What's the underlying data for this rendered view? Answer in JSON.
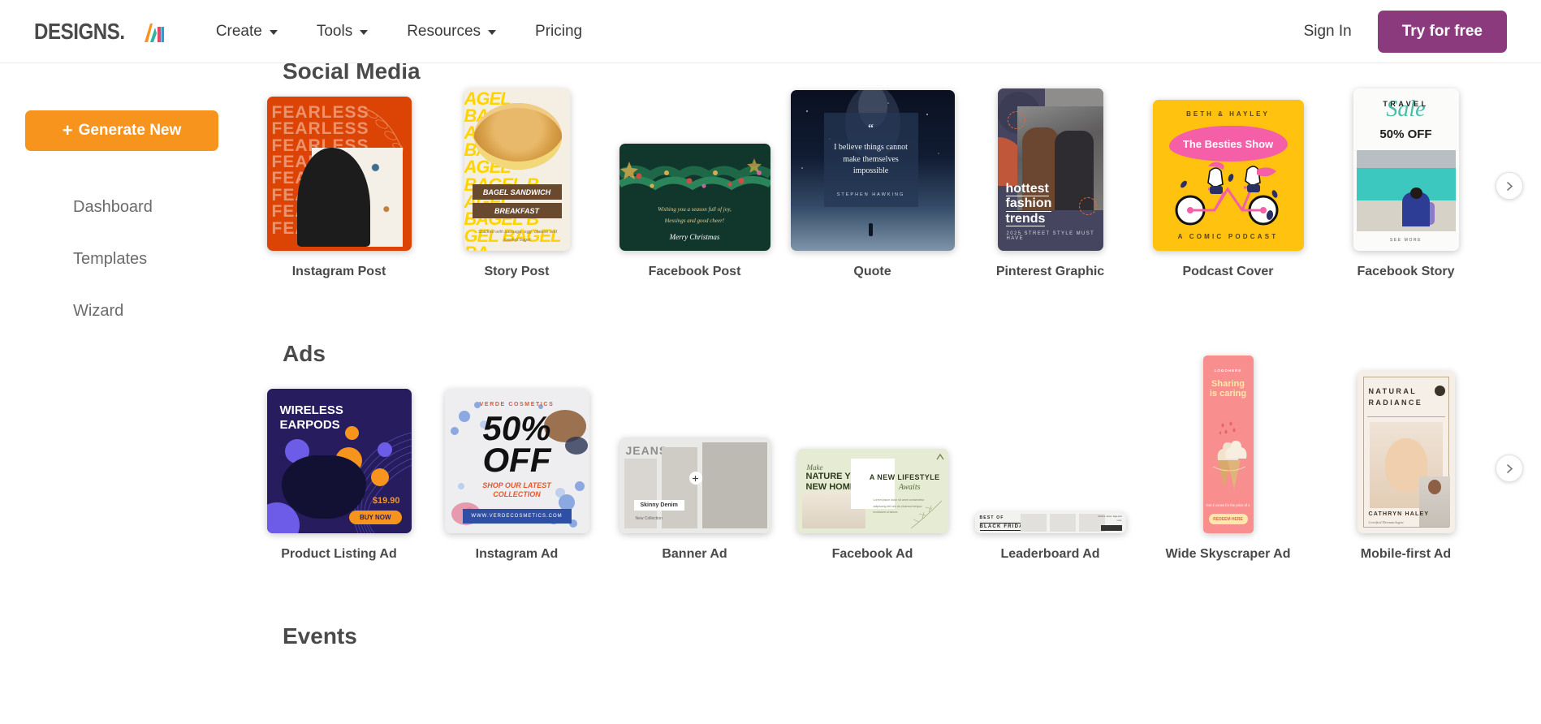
{
  "header": {
    "logo_text": "DESIGNS.",
    "logo_mark": "ai-logo-mark",
    "nav": [
      {
        "label": "Create",
        "has_dropdown": true
      },
      {
        "label": "Tools",
        "has_dropdown": true
      },
      {
        "label": "Resources",
        "has_dropdown": true
      },
      {
        "label": "Pricing",
        "has_dropdown": false
      }
    ],
    "sign_in": "Sign In",
    "try_free": "Try for free",
    "accent_purple": "#8b3a7e"
  },
  "sidebar": {
    "generate_button": "Generate New",
    "generate_plus": "+",
    "accent_orange": "#F7941D",
    "items": [
      {
        "label": "Dashboard"
      },
      {
        "label": "Templates"
      },
      {
        "label": "Wizard"
      }
    ]
  },
  "sections": [
    {
      "title": "Social Media",
      "next_arrow": "›",
      "cards": [
        {
          "label": "Instagram Post",
          "art": {
            "word": "FEARLESS"
          }
        },
        {
          "label": "Story Post",
          "art": {
            "line1": "BAGEL SANDWICH",
            "line2": "BREAKFAST",
            "body": "Stacked with sausage, egg, cheese and toasted bagel."
          }
        },
        {
          "label": "Facebook Post",
          "art": {
            "line1": "Wishing you a season full of joy,",
            "line2": "blessings and good cheer!",
            "merry": "Merry Christmas"
          }
        },
        {
          "label": "Quote",
          "art": {
            "mark": "“",
            "text": "I believe things cannot make themselves impossible",
            "author": "STEPHEN HAWKING"
          }
        },
        {
          "label": "Pinterest Graphic",
          "art": {
            "l1": "hottest",
            "l2": "fashion",
            "l3": "trends",
            "sub": "2025 STREET STYLE MUST HAVE"
          }
        },
        {
          "label": "Podcast Cover",
          "art": {
            "top": "BETH & HAYLEY",
            "title": "The Besties Show",
            "bottom": "A COMIC PODCAST"
          }
        },
        {
          "label": "Facebook Story",
          "art": {
            "travel": "TRAVEL",
            "sale": "Sale",
            "off": "50% OFF",
            "more": "SEE MORE"
          }
        }
      ]
    },
    {
      "title": "Ads",
      "next_arrow": "›",
      "cards": [
        {
          "label": "Product Listing Ad",
          "art": {
            "l1": "WIRELESS",
            "l2": "EARPODS",
            "price": "$19.90",
            "cta": "BUY NOW"
          }
        },
        {
          "label": "Instagram Ad",
          "art": {
            "brand": "VERDE COSMETICS",
            "off1": "50%",
            "off2": "OFF",
            "shop1": "SHOP OUR LATEST",
            "shop2": "COLLECTION",
            "url": "WWW.VERDECOSMETICS.COM"
          }
        },
        {
          "label": "Banner Ad",
          "art": {
            "title": "JEANS",
            "tag": "Skinny Denim",
            "sub": "New Collection"
          }
        },
        {
          "label": "Facebook Ad",
          "art": {
            "make": "Make",
            "l1": "NATURE YOUR",
            "l2": "NEW HOME",
            "right": "A NEW LIFESTYLE",
            "awaits": "Awaits"
          }
        },
        {
          "label": "Leaderboard Ad",
          "art": {
            "l1": "BEST OF",
            "l2": "BLACK FRIDAY"
          }
        },
        {
          "label": "Wide Skyscraper Ad",
          "art": {
            "logo": "LOGOHERE",
            "l1": "Sharing",
            "l2": "is caring",
            "sub": "Get 2 cones for the price of 1",
            "cta": "REDEEM HERE"
          }
        },
        {
          "label": "Mobile-first Ad",
          "art": {
            "l1": "NATURAL",
            "l2": "RADIANCE",
            "name": "CATHRYN HALEY",
            "role": "Certified Dermatologist"
          }
        }
      ]
    },
    {
      "title": "Events",
      "cards": []
    }
  ]
}
